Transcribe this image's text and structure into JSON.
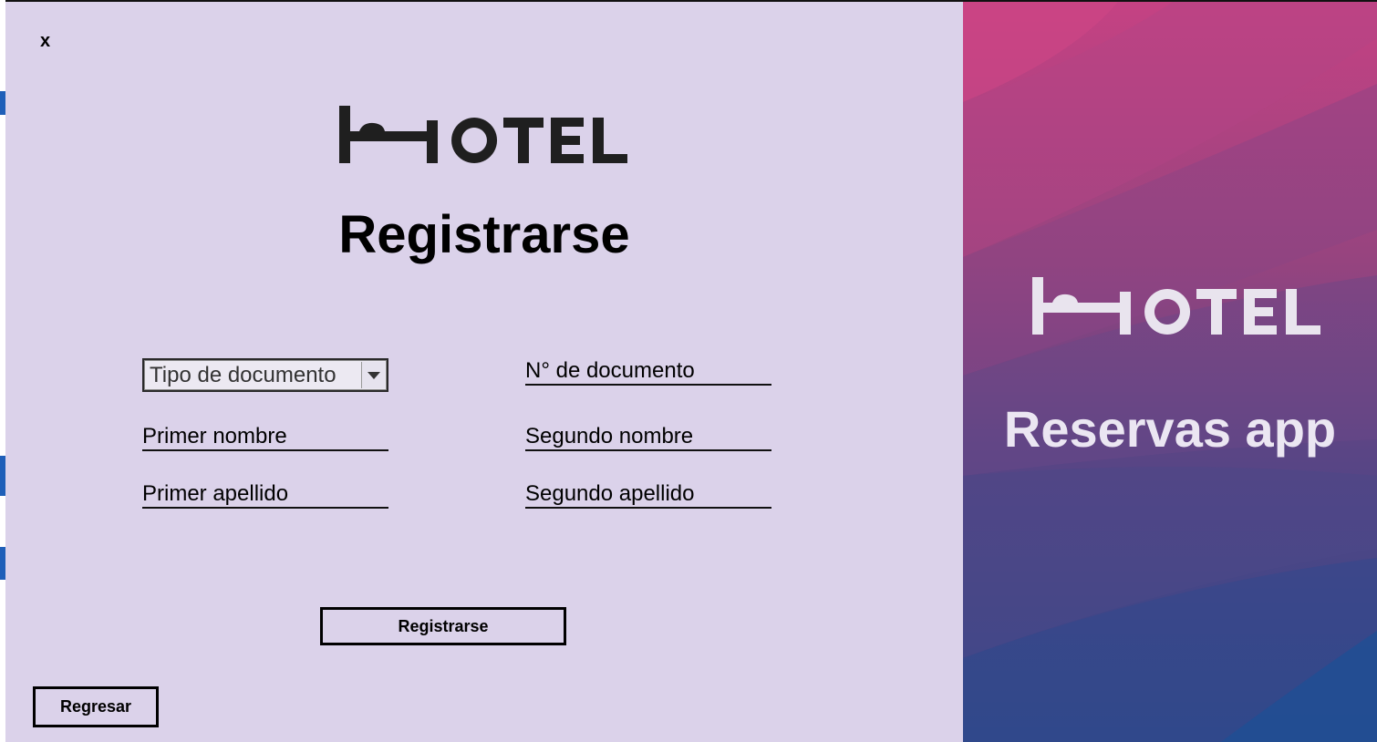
{
  "window": {
    "close_label": "x"
  },
  "form": {
    "title": "Registrarse",
    "logo_text": "HOTEL",
    "document_type": {
      "selected": "Tipo de documento"
    },
    "fields": {
      "document_number": "N° de documento",
      "first_name": "Primer nombre",
      "second_name": "Segundo nombre",
      "first_surname": "Primer apellido",
      "second_surname": "Segundo apellido"
    },
    "submit_label": "Registrarse",
    "back_label": "Regresar"
  },
  "brand_panel": {
    "logo_text": "HOTEL",
    "tagline": "Reservas app"
  },
  "colors": {
    "form_background": "#dbd2ea",
    "gradient_top": "#c03f7e",
    "gradient_bottom": "#2d4a8e"
  }
}
